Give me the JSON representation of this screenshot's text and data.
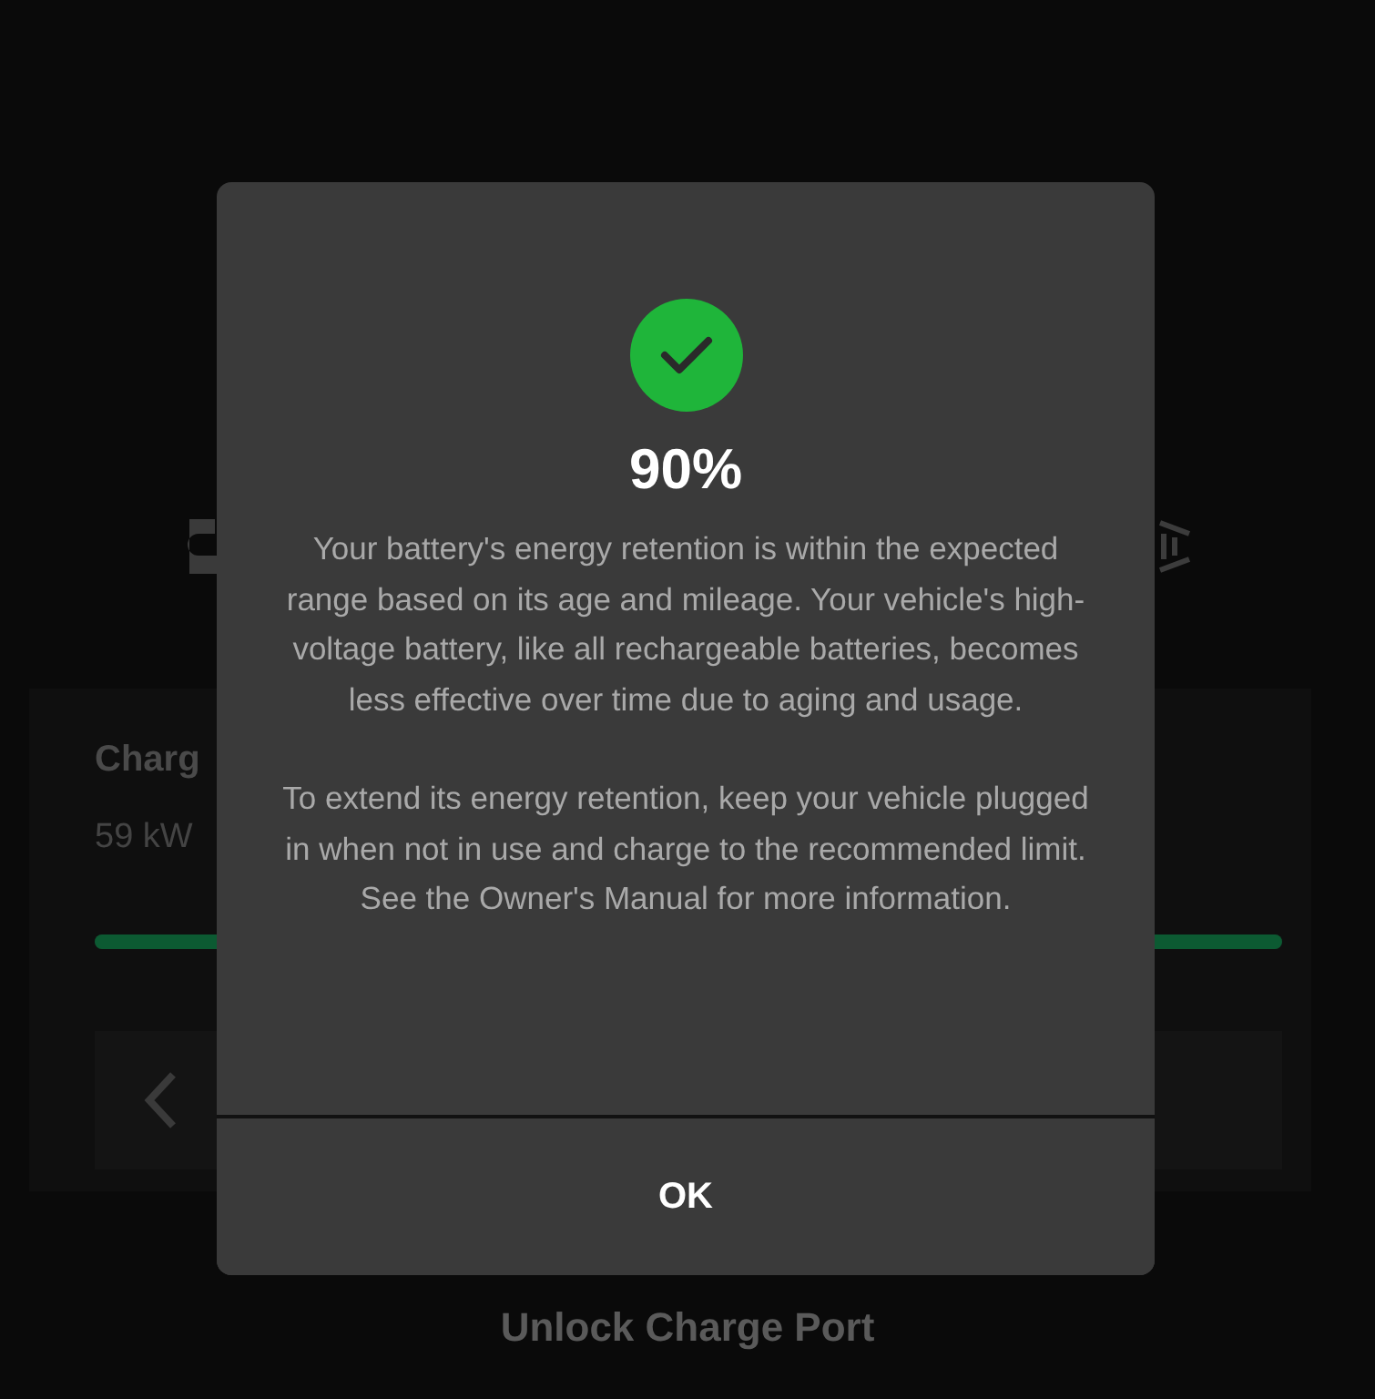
{
  "background": {
    "charge_title": "Charg",
    "charge_rate": "59 kW",
    "charge_bar": {
      "level": 1
    },
    "action": "Unlock Charge Port"
  },
  "dialog": {
    "value": "90%",
    "paragraphs": [
      "Your battery's energy retention is within the expected range based on its age and mileage. Your vehicle's high-voltage battery, like all rechargeable batteries, becomes less effective over time due to aging and usage.",
      "To extend its energy retention, keep your vehicle plugged in when not in use and charge to the recommended limit. See the Owner's Manual for more information."
    ],
    "button": "OK"
  }
}
